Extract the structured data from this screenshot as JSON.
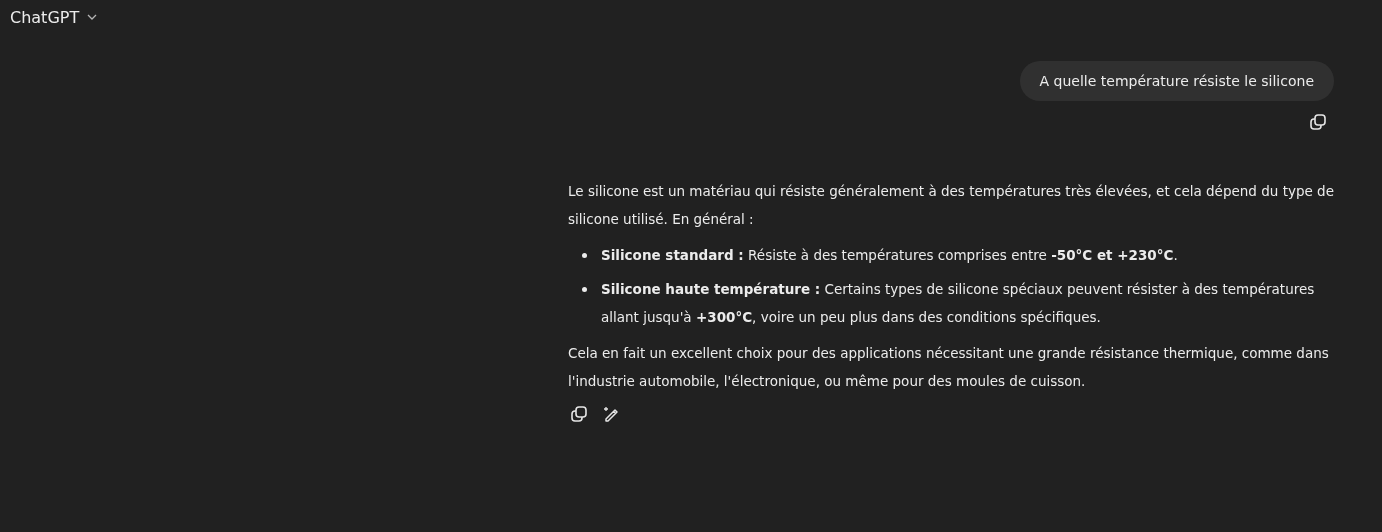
{
  "header": {
    "title": "ChatGPT"
  },
  "messages": [
    {
      "kind": "user",
      "text": "A quelle température résiste le silicone"
    },
    {
      "kind": "assistant",
      "blocks": [
        {
          "kind": "paragraph",
          "text": "Le silicone est un matériau qui résiste généralement à des températures très élevées, et cela dépend du type de silicone utilisé. En général :"
        },
        {
          "kind": "list",
          "items": [
            "**Silicone standard :** Résiste à des températures comprises entre **-50°C et +230°C**.",
            "**Silicone haute température :** Certains types de silicone spéciaux peuvent résister à des températures allant jusqu'à **+300°C**, voire un peu plus dans des conditions spécifiques."
          ]
        },
        {
          "kind": "paragraph",
          "text": "Cela en fait un excellent choix pour des applications nécessitant une grande résistance thermique, comme dans l'industrie automobile, l'électronique, ou même pour des moules de cuisson."
        }
      ]
    }
  ]
}
